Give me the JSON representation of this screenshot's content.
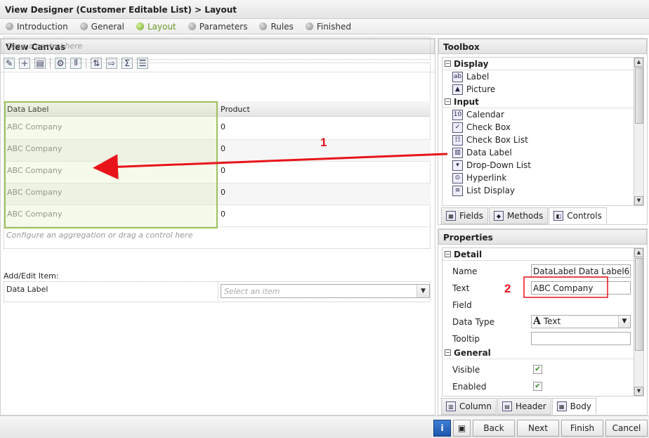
{
  "window": {
    "title": "View Designer (Customer Editable List) > Layout"
  },
  "steps": [
    {
      "label": "Introduction"
    },
    {
      "label": "General"
    },
    {
      "label": "Layout"
    },
    {
      "label": "Parameters"
    },
    {
      "label": "Rules"
    },
    {
      "label": "Finished"
    }
  ],
  "active_step": "Layout",
  "canvas": {
    "title": "View Canvas",
    "drop_hint": "Drag a control here",
    "columns": [
      "Data Label",
      "Product"
    ],
    "rows": [
      [
        "ABC Company",
        "0"
      ],
      [
        "ABC Company",
        "0"
      ],
      [
        "ABC Company",
        "0"
      ],
      [
        "ABC Company",
        "0"
      ],
      [
        "ABC Company",
        "0"
      ]
    ],
    "aggregation_hint": "Configure an aggregation or drag a control here",
    "add_edit": {
      "title": "Add/Edit Item:",
      "label": "Data Label",
      "select_placeholder": "Select an item"
    },
    "toolbar_icons": [
      "wand-icon",
      "add-table-icon",
      "edit-table-icon",
      "settings-icon",
      "columns-icon",
      "insert-row-icon",
      "export-icon",
      "sum-icon",
      "properties-icon"
    ]
  },
  "toolbox": {
    "title": "Toolbox",
    "groups": [
      {
        "name": "Display",
        "items": [
          {
            "label": "Label",
            "icon": "label-icon"
          },
          {
            "label": "Picture",
            "icon": "picture-icon"
          }
        ]
      },
      {
        "name": "Input",
        "items": [
          {
            "label": "Calendar",
            "icon": "calendar-icon"
          },
          {
            "label": "Check Box",
            "icon": "checkbox-icon"
          },
          {
            "label": "Check Box List",
            "icon": "checkbox-list-icon"
          },
          {
            "label": "Data Label",
            "icon": "data-label-icon"
          },
          {
            "label": "Drop-Down List",
            "icon": "dropdown-icon"
          },
          {
            "label": "Hyperlink",
            "icon": "hyperlink-icon"
          },
          {
            "label": "List Display",
            "icon": "list-display-icon"
          }
        ]
      }
    ],
    "tabs": [
      "Fields",
      "Methods",
      "Controls"
    ],
    "active_tab": "Controls"
  },
  "properties": {
    "title": "Properties",
    "detail_group": "Detail",
    "general_group": "General",
    "rows": {
      "name": {
        "label": "Name",
        "value": "DataLabel Data Label6"
      },
      "text": {
        "label": "Text",
        "value": "ABC Company"
      },
      "field": {
        "label": "Field"
      },
      "data_type": {
        "label": "Data Type",
        "value": "Text"
      },
      "tooltip": {
        "label": "Tooltip",
        "value": ""
      },
      "visible": {
        "label": "Visible",
        "checked": true
      },
      "enabled": {
        "label": "Enabled",
        "checked": true
      }
    },
    "tabs": [
      "Column",
      "Header",
      "Body"
    ],
    "active_tab": "Body"
  },
  "annotations": {
    "arrow_label": "1",
    "box_label": "2",
    "color": "#e8141a"
  },
  "footer": {
    "buttons": [
      "Back",
      "Next",
      "Finish",
      "Cancel"
    ]
  }
}
